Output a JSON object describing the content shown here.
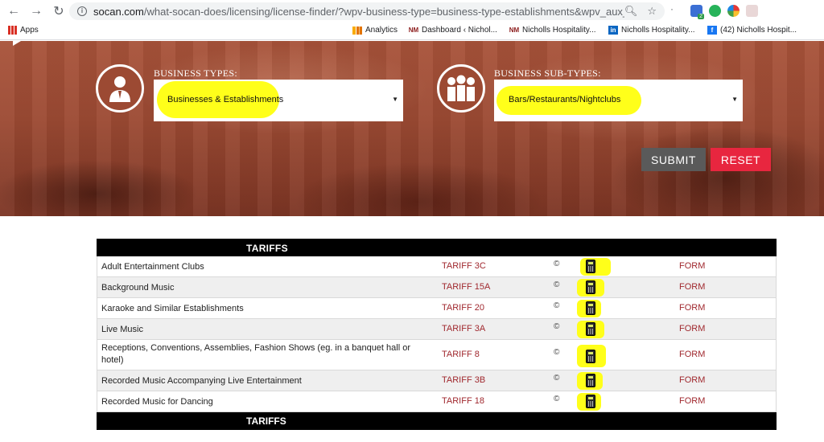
{
  "browser": {
    "url_host": "socan.com",
    "url_path": "/what-socan-does/licensing/license-finder/?wpv-business-type=business-type-establishments&wpv_aux_current_post...",
    "bookmarks": {
      "apps": "Apps",
      "analytics": "Analytics",
      "dashboard": "Dashboard ‹ Nichol...",
      "nicholls1": "Nicholls Hospitality...",
      "nicholls2": "Nicholls Hospitality...",
      "facebook": "(42) Nicholls Hospit..."
    },
    "fav_nm": "NM",
    "ext_badge": "2"
  },
  "form": {
    "business_types_label": "BUSINESS TYPES:",
    "business_type_value": "Businesses & Establishments",
    "business_subtypes_label": "BUSINESS SUB-TYPES:",
    "business_subtype_value": "Bars/Restaurants/Nightclubs",
    "submit_label": "SUBMIT",
    "reset_label": "RESET"
  },
  "table": {
    "header": "TARIFFS",
    "footer": "TARIFFS",
    "copyright_symbol": "©",
    "rows": [
      {
        "name": "Adult Entertainment Clubs",
        "tariff": "TARIFF 3C",
        "form": "FORM"
      },
      {
        "name": "Background Music",
        "tariff": "TARIFF 15A",
        "form": "FORM"
      },
      {
        "name": "Karaoke and Similar Establishments",
        "tariff": "TARIFF 20",
        "form": "FORM"
      },
      {
        "name": "Live Music",
        "tariff": "TARIFF 3A",
        "form": "FORM"
      },
      {
        "name": "Receptions, Conventions, Assemblies, Fashion Shows (eg. in a banquet hall or hotel)",
        "tariff": "TARIFF 8",
        "form": "FORM"
      },
      {
        "name": "Recorded Music Accompanying Live Entertainment",
        "tariff": "TARIFF 3B",
        "form": "FORM"
      },
      {
        "name": "Recorded Music for Dancing",
        "tariff": "TARIFF 18",
        "form": "FORM"
      }
    ]
  },
  "colors": {
    "accent_red": "#e8263f",
    "link_red": "#a0282e",
    "highlight_yellow": "#ffff1a",
    "hero_brown": "#9c4a33"
  }
}
